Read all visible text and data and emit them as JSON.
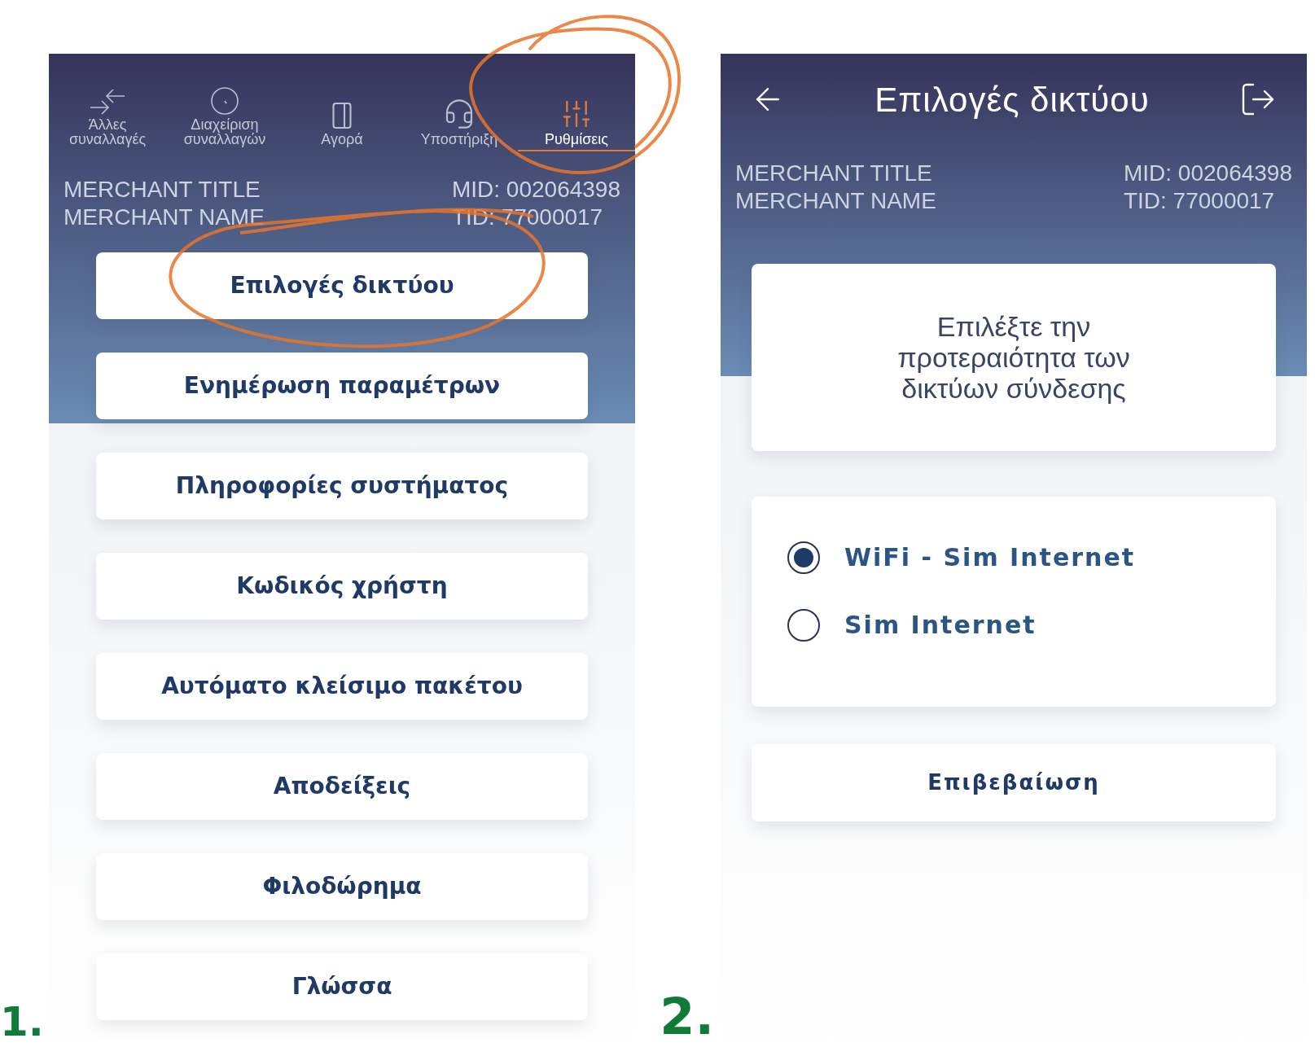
{
  "screen_1": {
    "label": "1.",
    "nav_tabs": [
      {
        "label": "Άλλες συναλλαγές",
        "selected": false
      },
      {
        "label": "Διαχείριση συναλλαγών",
        "selected": false
      },
      {
        "label": "Αγορά",
        "selected": false
      },
      {
        "label": "Υποστήριξη",
        "selected": false
      },
      {
        "label": "Ρυθμίσεις",
        "selected": true
      }
    ],
    "merchant": {
      "title": "MERCHANT TITLE",
      "name": "MERCHANT NAME",
      "mid": "MID: 002064398",
      "tid": "TID: 77000017"
    },
    "menu_items": [
      "Επιλογές δικτύου",
      "Ενημέρωση παραμέτρων",
      "Πληροφορίες συστήματος",
      "Κωδικός χρήστη",
      "Αυτόματο κλείσιμο πακέτου",
      "Αποδείξεις",
      "Φιλοδώρημα",
      "Γλώσσα"
    ]
  },
  "screen_2": {
    "label": "2.",
    "title": "Επιλογές δικτύου",
    "merchant": {
      "title": "MERCHANT TITLE",
      "name": "MERCHANT NAME",
      "mid": "MID: 002064398",
      "tid": "TID: 77000017"
    },
    "prompt": "Επιλέξτε την προτεραιότητα των δικτύων σύνδεσης",
    "options": [
      {
        "label": "WiFi - Sim Internet",
        "selected": true
      },
      {
        "label": "Sim Internet",
        "selected": false
      }
    ],
    "confirm_button": "Επιβεβαίωση"
  }
}
